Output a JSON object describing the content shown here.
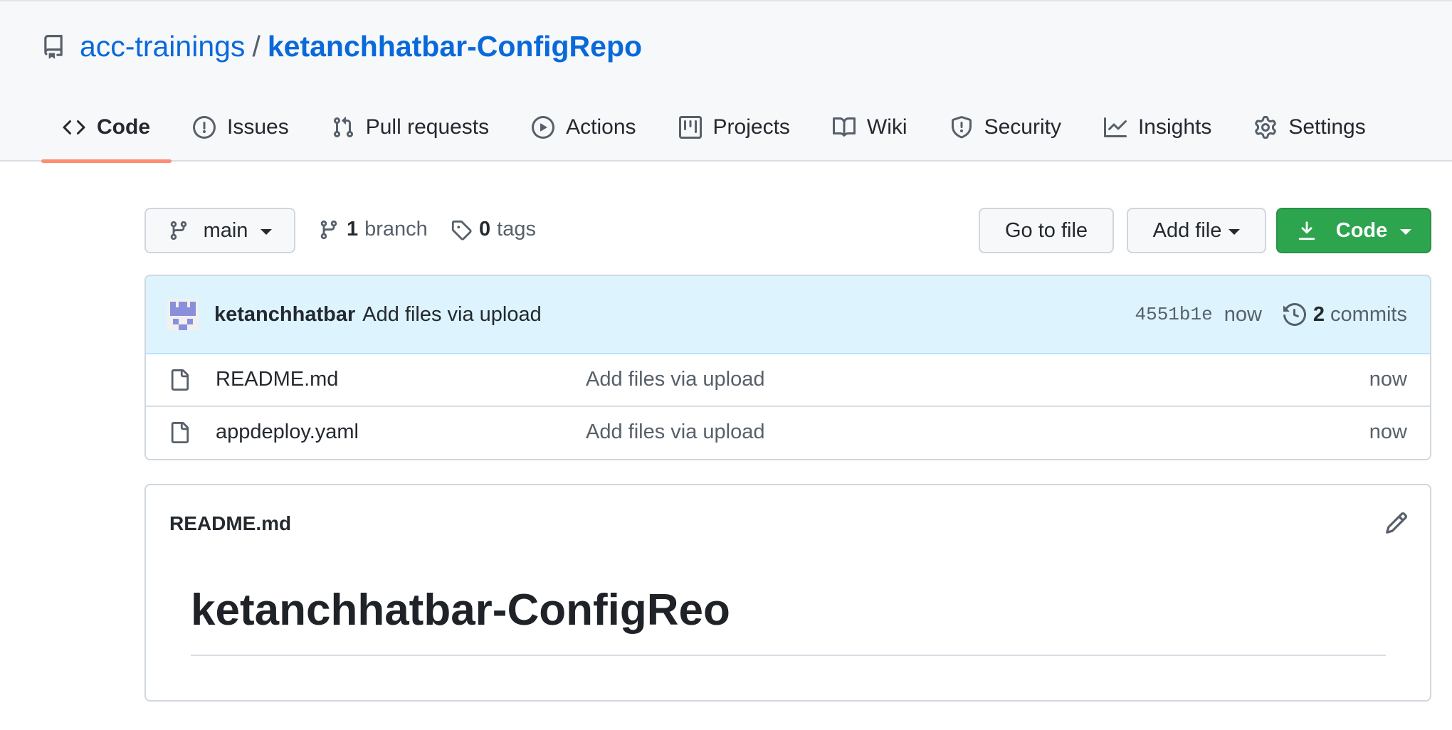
{
  "repo": {
    "owner": "acc-trainings",
    "separator": "/",
    "name": "ketanchhatbar-ConfigRepo"
  },
  "tabs": [
    {
      "label": "Code",
      "icon": "code-icon",
      "selected": true
    },
    {
      "label": "Issues",
      "icon": "issue-icon"
    },
    {
      "label": "Pull requests",
      "icon": "pull-request-icon"
    },
    {
      "label": "Actions",
      "icon": "play-icon"
    },
    {
      "label": "Projects",
      "icon": "project-icon"
    },
    {
      "label": "Wiki",
      "icon": "book-icon"
    },
    {
      "label": "Security",
      "icon": "shield-icon"
    },
    {
      "label": "Insights",
      "icon": "graph-icon"
    },
    {
      "label": "Settings",
      "icon": "gear-icon"
    }
  ],
  "toolbar": {
    "branch_label": "main",
    "branch_count": "1",
    "branch_word": "branch",
    "tag_count": "0",
    "tag_word": "tags",
    "goto_file_label": "Go to file",
    "add_file_label": "Add file",
    "code_label": "Code"
  },
  "commit": {
    "author": "ketanchhatbar",
    "message": "Add files via upload",
    "sha": "4551b1e",
    "time": "now",
    "commit_count": "2",
    "commit_word": "commits"
  },
  "files": [
    {
      "name": "README.md",
      "commit_message": "Add files via upload",
      "time": "now"
    },
    {
      "name": "appdeploy.yaml",
      "commit_message": "Add files via upload",
      "time": "now"
    }
  ],
  "readme": {
    "file_label": "README.md",
    "heading": "ketanchhatbar-ConfigReo"
  },
  "colors": {
    "link": "#0969da",
    "selected_tab_underline": "#fd8c73",
    "primary_button": "#2da44e",
    "commit_bar_bg": "#ddf4ff",
    "header_bg": "#f6f8fa"
  }
}
